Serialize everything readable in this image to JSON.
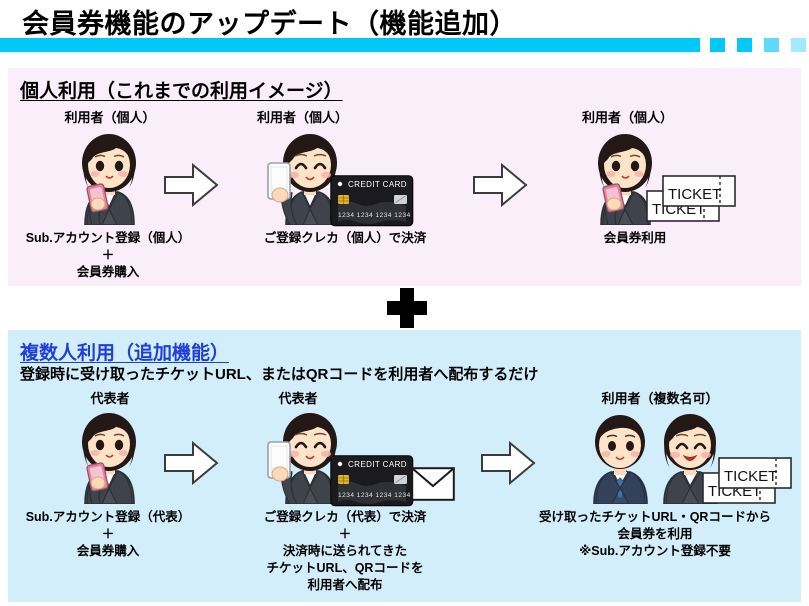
{
  "header": {
    "title": "会員券機能のアップデート（機能追加）",
    "accent_color": "#00c8f8"
  },
  "sections": [
    {
      "id": "personal",
      "heading": "個人利用（これまでの利用イメージ）",
      "subtitle": "",
      "background_color": "#fbeefb",
      "heading_color": "#000000",
      "steps": [
        {
          "actor_label": "利用者（個人）",
          "caption_lines": [
            "Sub.アカウント登録（個人）",
            "＋",
            "会員券購入"
          ]
        },
        {
          "actor_label": "利用者（個人）",
          "caption_lines": [
            "ご登録クレカ（個人）で決済"
          ]
        },
        {
          "actor_label": "利用者（個人）",
          "caption_lines": [
            "会員券利用"
          ]
        }
      ]
    },
    {
      "id": "group",
      "heading": "複数人利用（追加機能）",
      "subtitle": "登録時に受け取ったチケットURL、またはQRコードを利用者へ配布するだけ",
      "background_color": "#d3eefb",
      "heading_color": "#1f3fd6",
      "steps": [
        {
          "actor_label": "代表者",
          "caption_lines": [
            "Sub.アカウント登録（代表）",
            "＋",
            "会員券購入"
          ]
        },
        {
          "actor_label": "代表者",
          "caption_lines": [
            "ご登録クレカ（代表）で決済",
            "＋",
            "決済時に送られてきた",
            "チケットURL、QRコードを",
            "利用者へ配布"
          ]
        },
        {
          "actor_label": "利用者（複数名可）",
          "caption_lines": [
            "受け取ったチケットURL・QRコードから",
            "会員券を利用",
            "※Sub.アカウント登録不要"
          ]
        }
      ]
    }
  ],
  "graphics": {
    "credit_card_label": "CREDIT CARD",
    "credit_card_number": "1234 1234 1234 1234",
    "ticket_label": "TICKET",
    "plus_symbol": "+"
  }
}
